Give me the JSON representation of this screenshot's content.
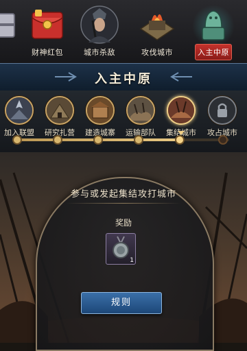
{
  "tabs": [
    {
      "label": "",
      "icon": "gift-chest-icon",
      "active": false
    },
    {
      "label": "财神红包",
      "icon": "red-envelope-icon",
      "active": false
    },
    {
      "label": "城市杀敌",
      "icon": "warrior-portrait-icon",
      "active": false
    },
    {
      "label": "攻伐城市",
      "icon": "burning-city-icon",
      "active": false
    },
    {
      "label": "入主中原",
      "icon": "jade-seal-icon",
      "active": true
    }
  ],
  "banner": {
    "title": "入主中原"
  },
  "steps": [
    {
      "label": "加入联盟",
      "icon": "alliance-icon",
      "state": "done"
    },
    {
      "label": "研究扎营",
      "icon": "camp-research-icon",
      "state": "done"
    },
    {
      "label": "建造城寨",
      "icon": "fortress-icon",
      "state": "done"
    },
    {
      "label": "运输部队",
      "icon": "transport-troops-icon",
      "state": "done"
    },
    {
      "label": "集结城市",
      "icon": "rally-city-icon",
      "state": "current"
    },
    {
      "label": "攻占城市",
      "icon": "lock-icon",
      "state": "locked"
    }
  ],
  "progress": {
    "completed_steps": 5,
    "total_steps": 6
  },
  "task": {
    "title": "参与或发起集结攻打城市",
    "reward_label": "奖励",
    "reward_item": {
      "icon": "medal-token-icon",
      "count": "1"
    },
    "rules_button": "规则"
  },
  "colors": {
    "gold": "#c9a566",
    "active_tab": "#c4322c",
    "banner": "#1d3148",
    "rules_button": "#2b5b91"
  }
}
